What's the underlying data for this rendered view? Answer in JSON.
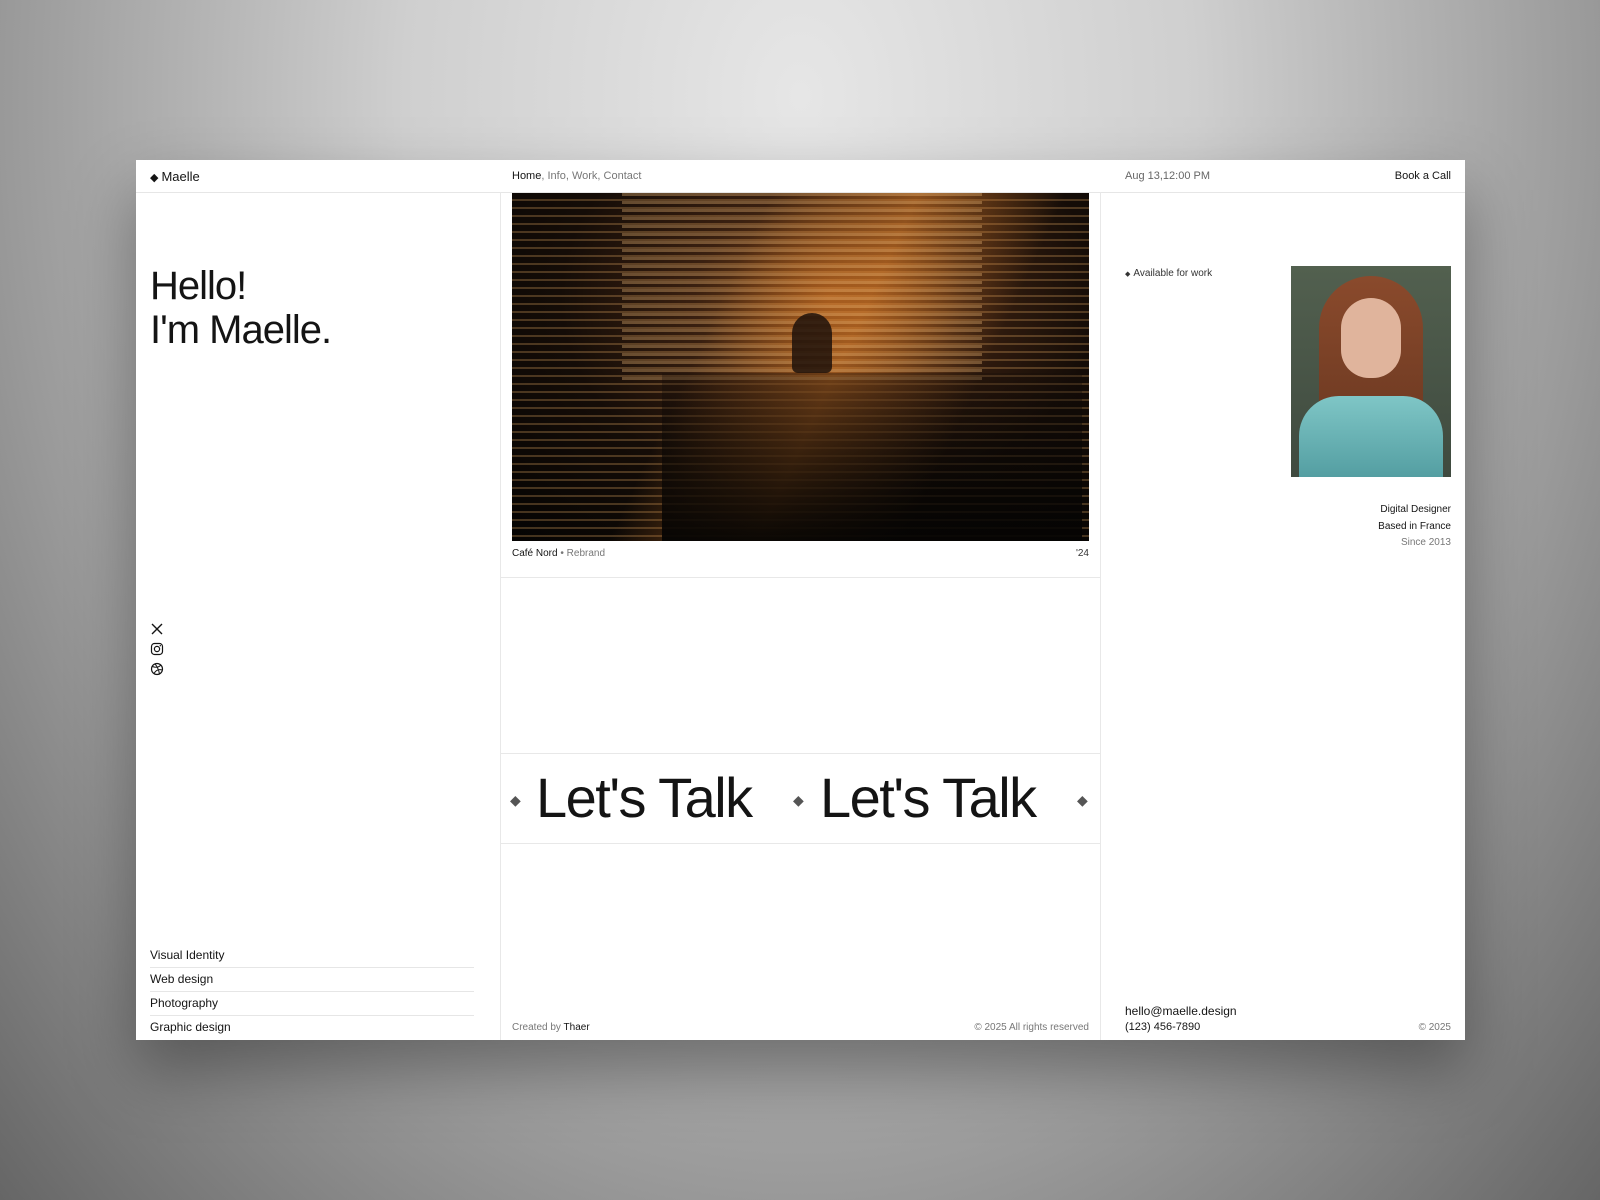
{
  "brand": {
    "logo_mark": "◆",
    "name": "Maelle"
  },
  "nav": {
    "items": [
      "Home",
      "Info",
      "Work",
      "Contact"
    ],
    "active": "Home"
  },
  "header": {
    "datetime": "Aug 13,12:00 PM",
    "cta_label": "Book a Call"
  },
  "hero": {
    "title": "Hello!\nI'm Maelle."
  },
  "socials": {
    "icons": [
      "x-icon",
      "instagram-icon",
      "dribbble-icon"
    ]
  },
  "services": {
    "items": [
      "Visual Identity",
      "Web design",
      "Photography",
      "Graphic design"
    ]
  },
  "feature": {
    "image_alt": "Café Nord interior",
    "project": "Café Nord",
    "separator": "•",
    "type": "Rebrand",
    "year": "'24"
  },
  "marquee": {
    "text": "Let's Talk",
    "marker": "◆"
  },
  "footer": {
    "created_prefix": "Created by",
    "author": "Thaer",
    "rights": "© 2025 All rights reserved",
    "copyright": "© 2025"
  },
  "profile": {
    "availability_mark": "◆",
    "availability": "Available for work",
    "role": "Digital Designer",
    "location": "Based in France",
    "since": "Since 2013"
  },
  "contact": {
    "email": "hello@maelle.design",
    "phone": "(123) 456-7890"
  }
}
